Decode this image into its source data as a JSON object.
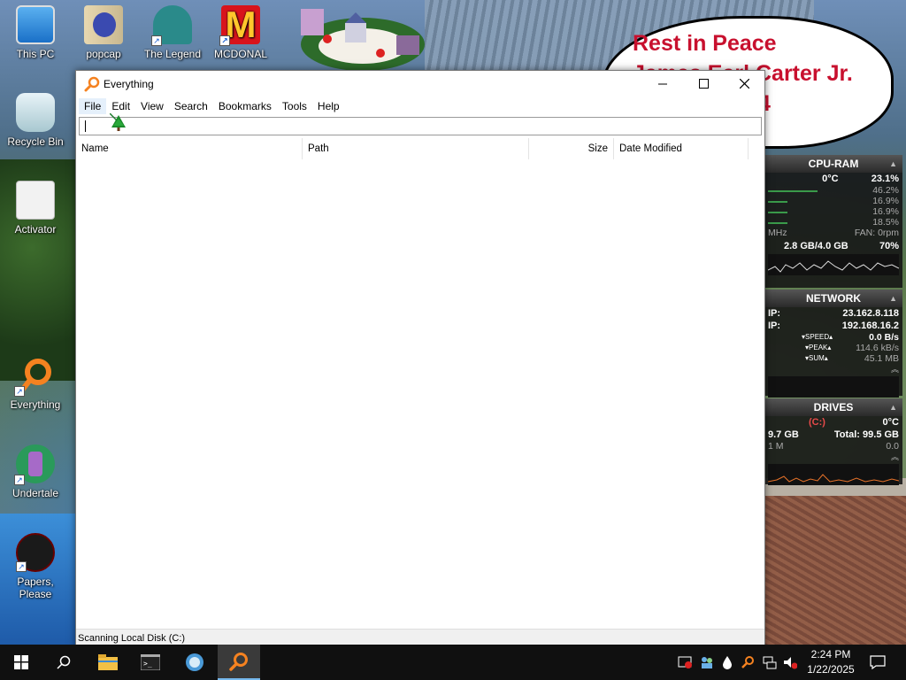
{
  "desktop": {
    "message": {
      "line1": "Rest in Peace",
      "line2": "James Earl Carter Jr.",
      "line3": "4"
    },
    "icons": [
      {
        "label": "This PC"
      },
      {
        "label": "popcap"
      },
      {
        "label": "The Legend"
      },
      {
        "label": "MCDONAL"
      },
      {
        "label": "Recycle Bin"
      },
      {
        "label": "Activator"
      },
      {
        "label": "Everything"
      },
      {
        "label": "Undertale"
      },
      {
        "label": "Papers, Please"
      }
    ]
  },
  "window": {
    "title": "Everything",
    "menu": [
      "File",
      "Edit",
      "View",
      "Search",
      "Bookmarks",
      "Tools",
      "Help"
    ],
    "search": {
      "value": ""
    },
    "columns": [
      "Name",
      "Path",
      "Size",
      "Date Modified"
    ],
    "status": "Scanning Local Disk (C:)"
  },
  "gadget": {
    "cpu": {
      "title": "CPU-RAM",
      "temp": "0°C",
      "total": "23.1%",
      "cores": [
        "46.2%",
        "16.9%",
        "16.9%",
        "18.5%"
      ],
      "mhz": "MHz",
      "fan": "FAN: 0rpm",
      "ram": "2.8 GB/4.0 GB",
      "ram_pct": "70%"
    },
    "network": {
      "title": "NETWORK",
      "ip1_label": "IP:",
      "ip1": "23.162.8.118",
      "ip2_label": "IP:",
      "ip2": "192.168.16.2",
      "speed_label": "SPEED",
      "speed": "0.0 B/s",
      "peak_label": "PEAK",
      "peak": "114.6 kB/s",
      "sum_label": "SUM",
      "sum": "45.1 MB"
    },
    "drives": {
      "title": "DRIVES",
      "drive": "(C:)",
      "temp": "0°C",
      "free": "9.7 GB",
      "total": "Total: 99.5 GB",
      "rate_label": "1 M",
      "rate": "0.0"
    }
  },
  "taskbar": {
    "time": "2:24 PM",
    "date": "1/22/2025"
  },
  "colors": {
    "accent": "#76b9ed",
    "message": "#c8102e",
    "everything_orange": "#f58220"
  }
}
